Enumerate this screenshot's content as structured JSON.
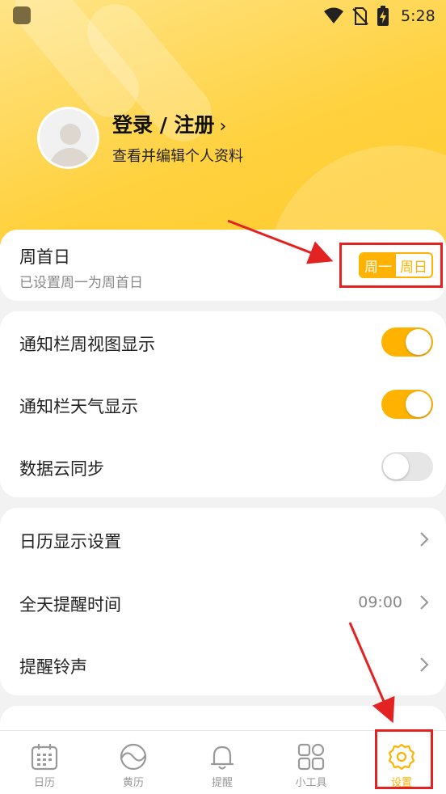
{
  "status_bar": {
    "time": "5:28"
  },
  "profile": {
    "login_label": "登录 / 注册",
    "chevron": "›",
    "subtitle": "查看并编辑个人资料"
  },
  "week_start": {
    "title": "周首日",
    "subtitle": "已设置周一为周首日",
    "options": [
      "周一",
      "周日"
    ],
    "selected": "周一"
  },
  "toggles": [
    {
      "label": "通知栏周视图显示",
      "on": true
    },
    {
      "label": "通知栏天气显示",
      "on": true
    },
    {
      "label": "数据云同步",
      "on": false
    }
  ],
  "settings_list": [
    {
      "label": "日历显示设置",
      "value": ""
    },
    {
      "label": "全天提醒时间",
      "value": "09:00"
    },
    {
      "label": "提醒铃声",
      "value": ""
    }
  ],
  "tabbar": {
    "items": [
      {
        "label": "日历",
        "icon": "calendar-icon",
        "active": false
      },
      {
        "label": "黄历",
        "icon": "almanac-icon",
        "active": false
      },
      {
        "label": "提醒",
        "icon": "bell-icon",
        "active": false
      },
      {
        "label": "小工具",
        "icon": "tools-icon",
        "active": false
      },
      {
        "label": "设置",
        "icon": "settings-icon",
        "active": true
      }
    ]
  },
  "colors": {
    "accent": "#ffb300",
    "header_yellow": "#ffd13e",
    "annotation_red": "#e32222"
  }
}
